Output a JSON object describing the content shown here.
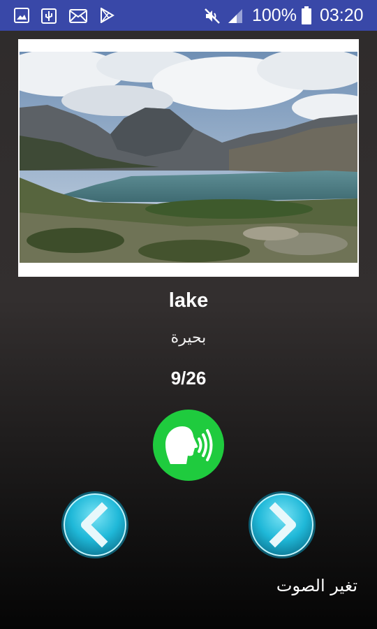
{
  "status_bar": {
    "battery_percent": "100%",
    "time": "03:20",
    "icons": [
      "gallery-icon",
      "usb-icon",
      "mail-icon",
      "play-store-icon",
      "mute-icon",
      "signal-icon",
      "battery-icon"
    ]
  },
  "card": {
    "word": "lake",
    "translation": "بحيرة",
    "counter": "9/26"
  },
  "controls": {
    "speak_icon": "speaking-head-icon",
    "prev_icon": "chevron-left-icon",
    "next_icon": "chevron-right-icon",
    "change_voice_label": "تغير الصوت"
  },
  "colors": {
    "status_bar": "#3948a8",
    "speak_button": "#1fcb3e",
    "nav_button": "#1fb8d8"
  }
}
